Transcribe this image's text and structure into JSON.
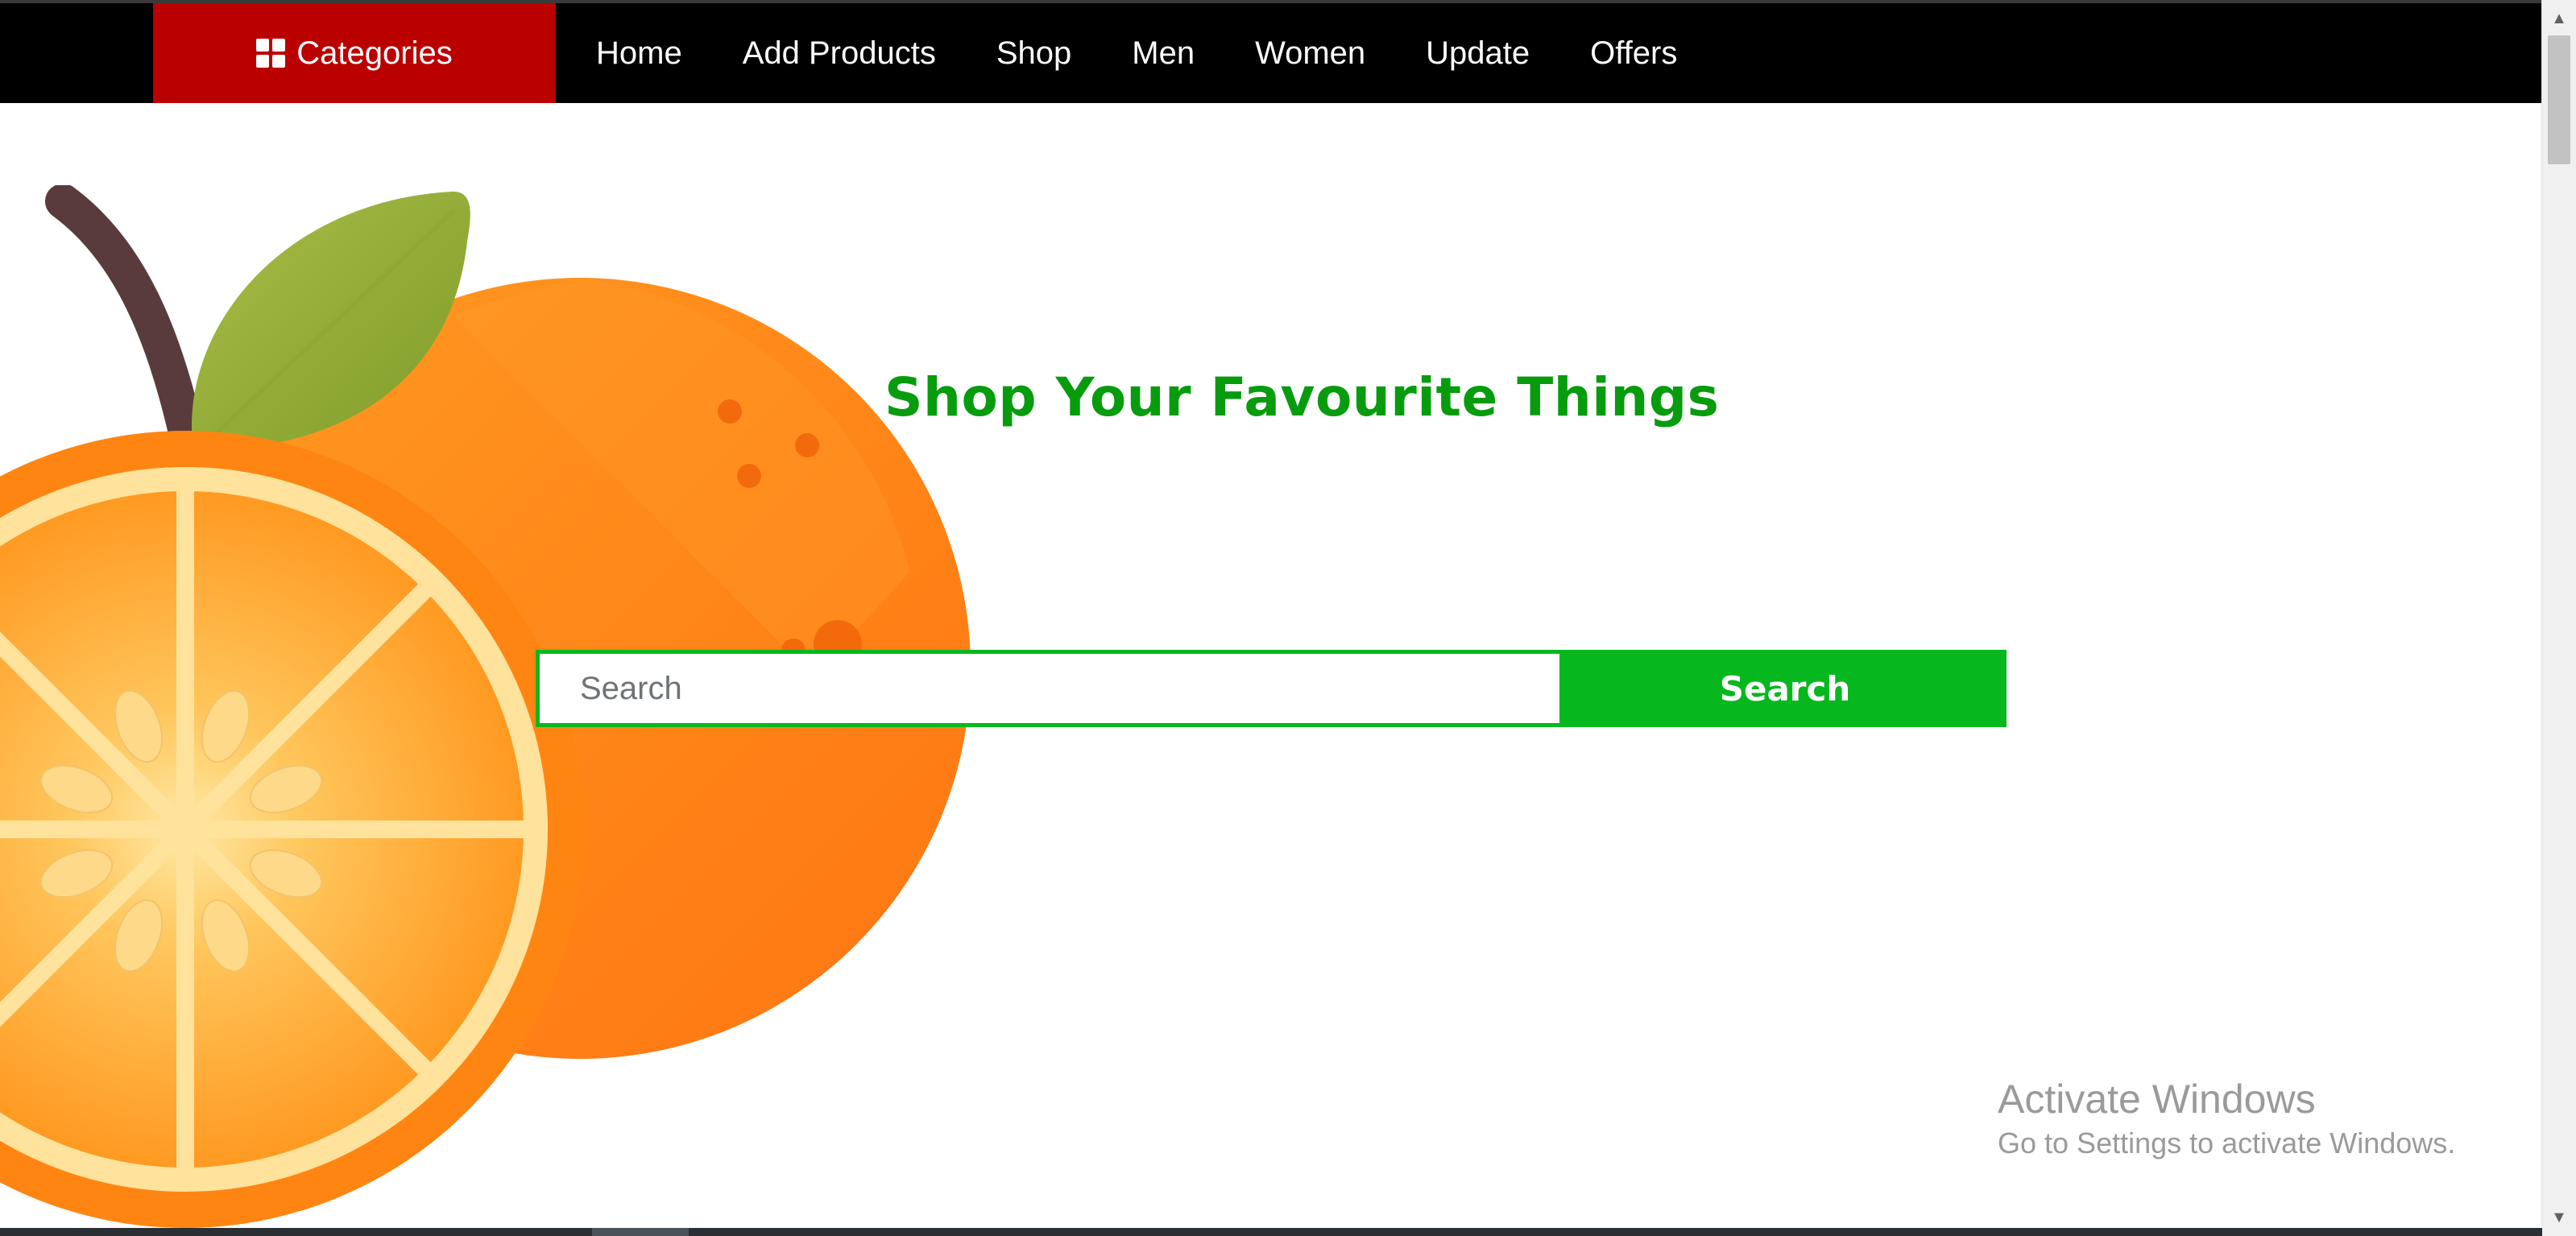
{
  "nav": {
    "categories_label": "Categories",
    "links": [
      "Home",
      "Add Products",
      "Shop",
      "Men",
      "Women",
      "Update",
      "Offers"
    ]
  },
  "hero": {
    "headline": "Shop Your Favourite Things"
  },
  "search": {
    "placeholder": "Search",
    "button_label": "Search"
  },
  "watermark": {
    "title": "Activate Windows",
    "subtitle": "Go to Settings to activate Windows."
  },
  "colors": {
    "nav_bg": "#000000",
    "categories_bg": "#bb0000",
    "accent_green": "#06b81d",
    "headline_green": "#079c0d",
    "orange": "#ff8a1a"
  },
  "icons": {
    "categories": "grid-icon",
    "illustration": "orange-fruit-illustration"
  }
}
